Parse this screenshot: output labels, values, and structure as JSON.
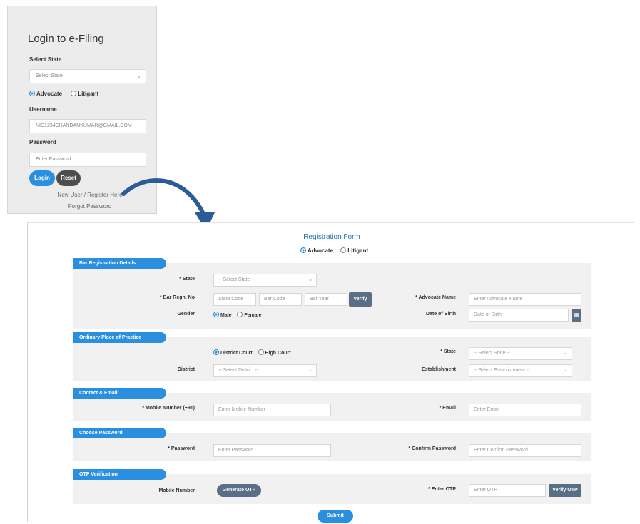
{
  "login": {
    "title": "Login to e-Filing",
    "state_label": "Select State",
    "state_value": "Select State",
    "radio_advocate": "Advocate",
    "radio_litigant": "Litigant",
    "username_label": "Username",
    "username_value": "NIC1234CHANDANKUMAR@GMAIL.COM",
    "password_label": "Password",
    "password_placeholder": "Enter Password",
    "login_button": "Login",
    "reset_button": "Reset",
    "new_user_link": "New User / Register Here",
    "forgot_link": "Forgot Password"
  },
  "registration": {
    "title": "Registration Form",
    "radio_advocate": "Advocate",
    "radio_litigant": "Litigant",
    "sections": {
      "bar": "Bar Registration Details",
      "place": "Ordinary Place of Practice",
      "contact": "Contact & Email",
      "password": "Choose Password",
      "otp": "OTP Verification"
    },
    "bar": {
      "state_label": "* State",
      "state_value": "-- Select State --",
      "bar_reg_label": "* Bar Regn. No",
      "bar_state_ph": "State Code",
      "bar_no_ph": "Bar Code",
      "bar_year_ph": "Bar Year",
      "verify_button": "Verify",
      "advocate_name_label": "* Advocate Name",
      "advocate_name_ph": "Enter Advocate Name",
      "gender_label": "Gender",
      "gender_male": "Male",
      "gender_female": "Female",
      "dob_label": "Date of Birth",
      "dob_ph": "Date of Birth"
    },
    "place": {
      "district_court": "District Court",
      "high_court": "High Court",
      "state_label": "* State",
      "state_value": "-- Select State --",
      "district_label": "District",
      "district_value": "-- Select District --",
      "establishment_label": "Establishment",
      "establishment_value": "-- Select Establishment --"
    },
    "contact": {
      "mobile_label": "* Mobile Number (+91)",
      "mobile_ph": "Enter Mobile Number",
      "email_label": "* Email",
      "email_ph": "Enter Email"
    },
    "password": {
      "password_label": "* Password",
      "password_ph": "Enter Password",
      "confirm_label": "* Confirm Password",
      "confirm_ph": "Enter Confirm Password"
    },
    "otp": {
      "mobile_label": "Mobile Number",
      "generate_button": "Generate OTP",
      "enter_otp_label": "* Enter OTP",
      "enter_otp_ph": "Enter OTP",
      "verify_button": "Verify OTP"
    },
    "submit_button": "Submit"
  },
  "colors": {
    "accent": "#2a8fde",
    "dark_button": "#5a6f86",
    "panel": "#ececec"
  }
}
